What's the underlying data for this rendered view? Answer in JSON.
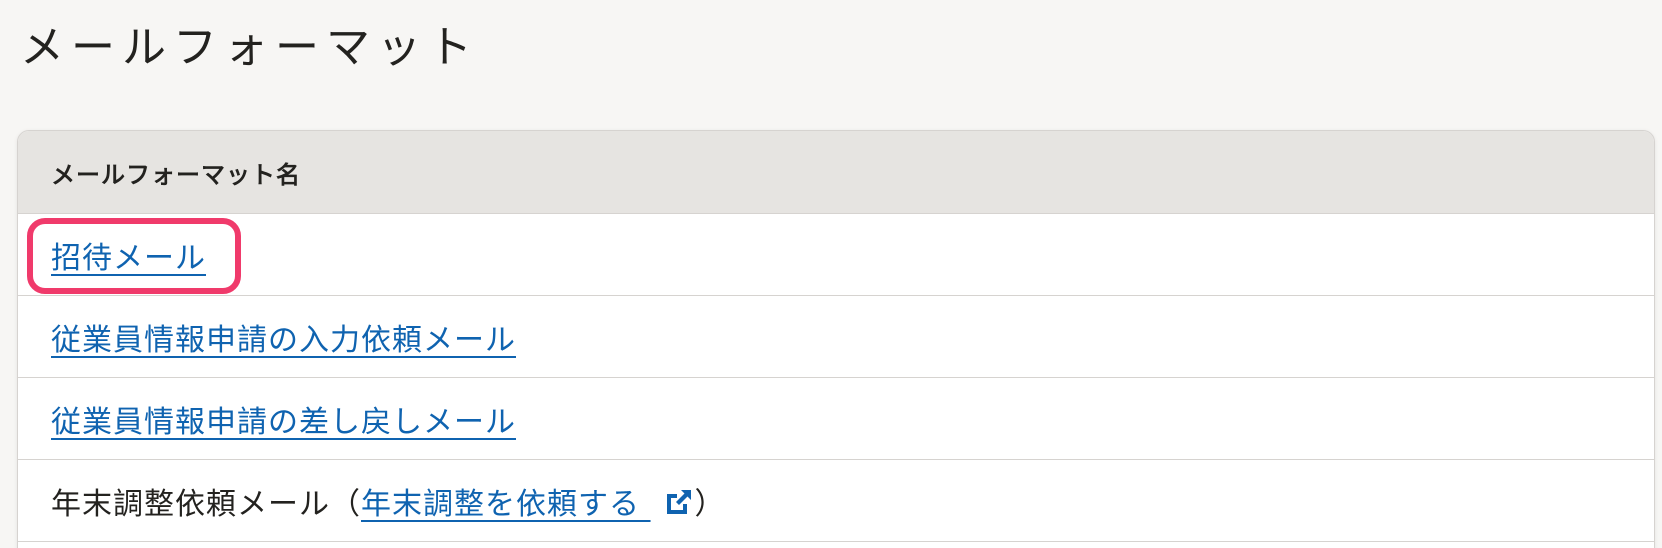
{
  "page": {
    "title": "メールフォーマット"
  },
  "table": {
    "header": "メールフォーマット名",
    "rows": [
      {
        "link": "招待メール"
      },
      {
        "link": "従業員情報申請の入力依頼メール"
      },
      {
        "link": "従業員情報申請の差し戻しメール"
      },
      {
        "text": "年末調整依頼メール",
        "paren_open": "（",
        "link": "年末調整を依頼する",
        "paren_close": "）",
        "icon": "external-link-icon"
      }
    ]
  },
  "colors": {
    "link": "#0f63b0",
    "highlight": "#f03a6b",
    "header_bg": "#e6e4e1",
    "page_bg": "#f7f6f4"
  }
}
